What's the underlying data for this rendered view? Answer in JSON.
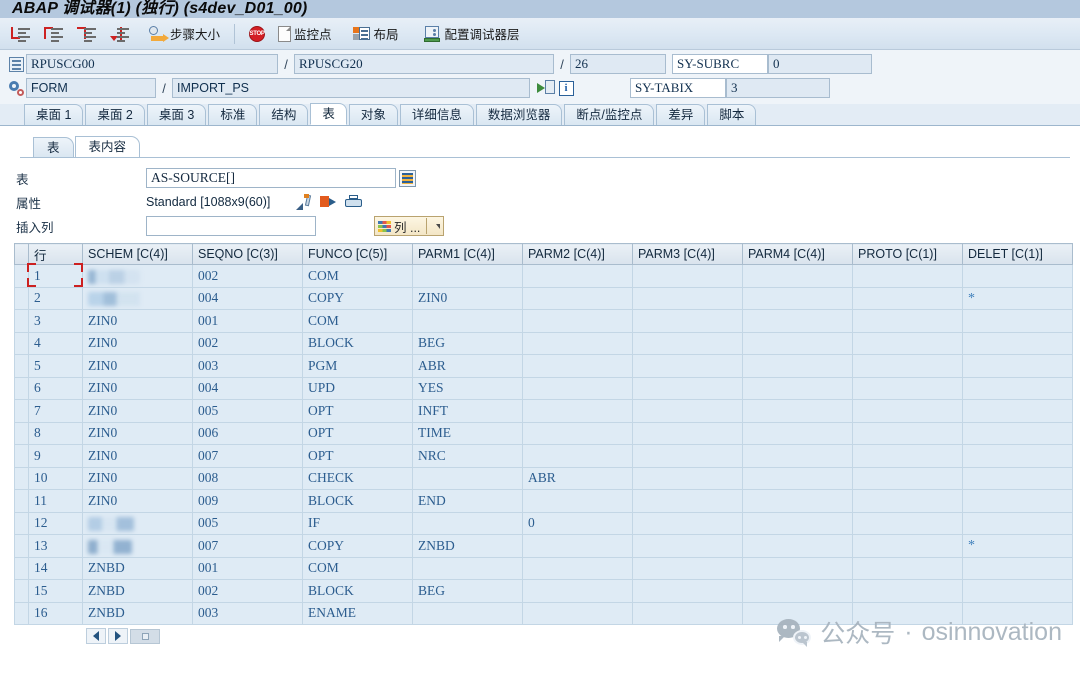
{
  "window": {
    "title_main": "ABAP 调试器",
    "title_inst": "(1)",
    "title_mode": "(独行)",
    "title_system": "(s4dev_D01_00)",
    "title_full": "ABAP 调试器(1) (独行) (s4dev_D01_00)"
  },
  "toolbar": {
    "items": [
      {
        "name": "step-into-button",
        "label": "",
        "icon": "step-into-icon"
      },
      {
        "name": "step-over-button",
        "label": "",
        "icon": "step-over-icon"
      },
      {
        "name": "step-return-button",
        "label": "",
        "icon": "step-return-icon"
      },
      {
        "name": "continue-button",
        "label": "",
        "icon": "continue-icon"
      }
    ],
    "step_size_label": "步骤大小",
    "breakpoint_label": "",
    "watchpoint_label": "监控点",
    "layout_label": "布局",
    "config_layer_label": "配置调试器层"
  },
  "fields": {
    "program_main": "RPUSCG00",
    "program_include": "RPUSCG20",
    "line_number": "26",
    "sy_subrc_label": "SY-SUBRC",
    "sy_subrc_value": "0",
    "event_type": "FORM",
    "event_name": "IMPORT_PS",
    "sy_tabix_label": "SY-TABIX",
    "sy_tabix_value": "3",
    "separator": "/"
  },
  "tabs": {
    "items": [
      {
        "label": "桌面 1",
        "active": false
      },
      {
        "label": "桌面 2",
        "active": false
      },
      {
        "label": "桌面 3",
        "active": false
      },
      {
        "label": "标准",
        "active": false
      },
      {
        "label": "结构",
        "active": false
      },
      {
        "label": "表",
        "active": true
      },
      {
        "label": "对象",
        "active": false
      },
      {
        "label": "详细信息",
        "active": false
      },
      {
        "label": "数据浏览器",
        "active": false
      },
      {
        "label": "断点/监控点",
        "active": false
      },
      {
        "label": "差异",
        "active": false
      },
      {
        "label": "脚本",
        "active": false
      }
    ]
  },
  "inner_tabs": {
    "items": [
      {
        "label": "表",
        "active": false
      },
      {
        "label": "表内容",
        "active": true
      }
    ]
  },
  "form": {
    "table_label": "表",
    "table_value": "AS-SOURCE[]",
    "attr_label": "属性",
    "attr_value": "Standard [1088x9(60)]",
    "insert_col_label": "插入列",
    "insert_col_value": "",
    "columns_button_label": "列 ..."
  },
  "grid": {
    "row_header": "行",
    "columns": [
      "SCHEM [C(4)]",
      "SEQNO [C(3)]",
      "FUNCO [C(5)]",
      "PARM1 [C(4)]",
      "PARM2 [C(4)]",
      "PARM3 [C(4)]",
      "PARM4 [C(4)]",
      "PROTO [C(1)]",
      "DELET [C(1)]"
    ],
    "rows": [
      {
        "n": "1",
        "schem": "",
        "blur": "b1",
        "seqno": "002",
        "funco": "COM",
        "parm1": "",
        "parm2": "",
        "parm3": "",
        "parm4": "",
        "proto": "",
        "delet": ""
      },
      {
        "n": "2",
        "schem": "",
        "blur": "b2",
        "seqno": "004",
        "funco": "COPY",
        "parm1": "ZIN0",
        "parm2": "",
        "parm3": "",
        "parm4": "",
        "proto": "",
        "delet": "*"
      },
      {
        "n": "3",
        "schem": "ZIN0",
        "blur": "",
        "seqno": "001",
        "funco": "COM",
        "parm1": "",
        "parm2": "",
        "parm3": "",
        "parm4": "",
        "proto": "",
        "delet": ""
      },
      {
        "n": "4",
        "schem": "ZIN0",
        "blur": "",
        "seqno": "002",
        "funco": "BLOCK",
        "parm1": "BEG",
        "parm2": "",
        "parm3": "",
        "parm4": "",
        "proto": "",
        "delet": ""
      },
      {
        "n": "5",
        "schem": "ZIN0",
        "blur": "",
        "seqno": "003",
        "funco": "PGM",
        "parm1": "ABR",
        "parm2": "",
        "parm3": "",
        "parm4": "",
        "proto": "",
        "delet": ""
      },
      {
        "n": "6",
        "schem": "ZIN0",
        "blur": "",
        "seqno": "004",
        "funco": "UPD",
        "parm1": "YES",
        "parm2": "",
        "parm3": "",
        "parm4": "",
        "proto": "",
        "delet": ""
      },
      {
        "n": "7",
        "schem": "ZIN0",
        "blur": "",
        "seqno": "005",
        "funco": "OPT",
        "parm1": "INFT",
        "parm2": "",
        "parm3": "",
        "parm4": "",
        "proto": "",
        "delet": ""
      },
      {
        "n": "8",
        "schem": "ZIN0",
        "blur": "",
        "seqno": "006",
        "funco": "OPT",
        "parm1": "TIME",
        "parm2": "",
        "parm3": "",
        "parm4": "",
        "proto": "",
        "delet": ""
      },
      {
        "n": "9",
        "schem": "ZIN0",
        "blur": "",
        "seqno": "007",
        "funco": "OPT",
        "parm1": "NRC",
        "parm2": "",
        "parm3": "",
        "parm4": "",
        "proto": "",
        "delet": ""
      },
      {
        "n": "10",
        "schem": "ZIN0",
        "blur": "",
        "seqno": "008",
        "funco": "CHECK",
        "parm1": "",
        "parm2": "ABR",
        "parm3": "",
        "parm4": "",
        "proto": "",
        "delet": ""
      },
      {
        "n": "11",
        "schem": "ZIN0",
        "blur": "",
        "seqno": "009",
        "funco": "BLOCK",
        "parm1": "END",
        "parm2": "",
        "parm3": "",
        "parm4": "",
        "proto": "",
        "delet": ""
      },
      {
        "n": "12",
        "schem": "",
        "blur": "b3",
        "seqno": "005",
        "funco": "IF",
        "parm1": "",
        "parm2": "0",
        "parm3": "",
        "parm4": "",
        "proto": "",
        "delet": ""
      },
      {
        "n": "13",
        "schem": "",
        "blur": "b4",
        "seqno": "007",
        "funco": "COPY",
        "parm1": "ZNBD",
        "parm2": "",
        "parm3": "",
        "parm4": "",
        "proto": "",
        "delet": "*"
      },
      {
        "n": "14",
        "schem": "ZNBD",
        "blur": "",
        "seqno": "001",
        "funco": "COM",
        "parm1": "",
        "parm2": "",
        "parm3": "",
        "parm4": "",
        "proto": "",
        "delet": ""
      },
      {
        "n": "15",
        "schem": "ZNBD",
        "blur": "",
        "seqno": "002",
        "funco": "BLOCK",
        "parm1": "BEG",
        "parm2": "",
        "parm3": "",
        "parm4": "",
        "proto": "",
        "delet": ""
      },
      {
        "n": "16",
        "schem": "ZNBD",
        "blur": "",
        "seqno": "003",
        "funco": "ENAME",
        "parm1": "",
        "parm2": "",
        "parm3": "",
        "parm4": "",
        "proto": "",
        "delet": ""
      }
    ]
  },
  "watermark": {
    "prefix": "公众号",
    "dot": "·",
    "name": "osinnovation"
  },
  "colors": {
    "titlebar": "#b4c8de",
    "toolbar": "#dce8f3",
    "grid_cell_bg": "#dfebf5",
    "grid_text": "#2c5d8f",
    "selection_red": "#cc2020",
    "accent_blue": "#2a6099"
  }
}
